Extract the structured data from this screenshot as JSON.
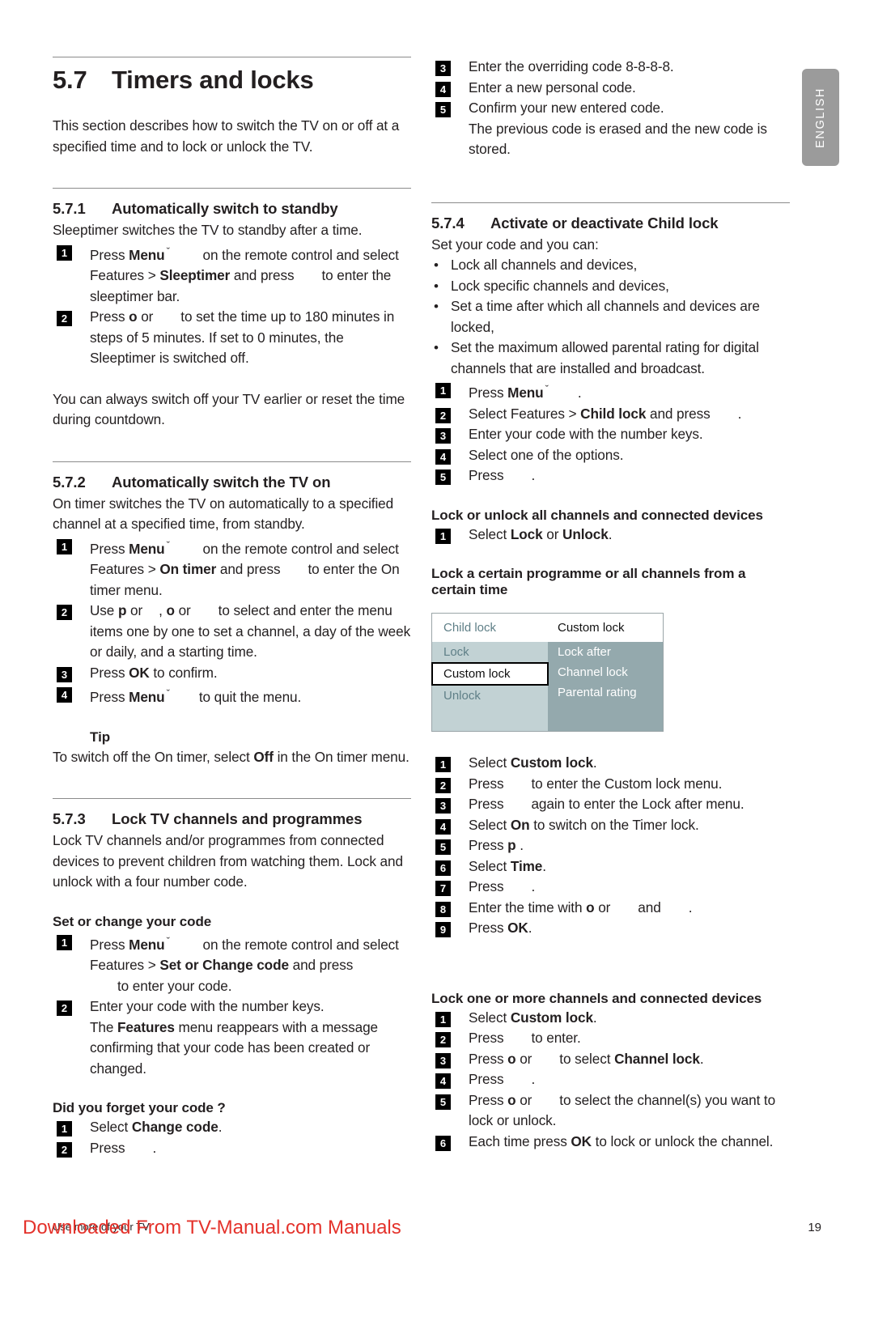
{
  "language_tab": {
    "label": "ENGLISH"
  },
  "chapter": {
    "number": "5.7",
    "title": "Timers and locks"
  },
  "intro": "This section describes how to switch the TV on or off at a specified time and to lock or unlock the TV.",
  "s571": {
    "number": "5.7.1",
    "title": "Automatically switch to standby",
    "intro": "Sleeptimer switches the TV to standby after a time.",
    "step1_a": "Press ",
    "step1_b": "Menu",
    "step1_c": " on the remote control and select Features > ",
    "step1_d": "Sleeptimer",
    "step1_e": " and press",
    "step1_f": "to enter the sleeptimer bar.",
    "step2_a": "Press ",
    "step2_b": "o",
    "step2_c": " or",
    "step2_d": "to set the time up to 180 minutes in steps of 5 minutes. If set to 0 minutes, the Sleeptimer is switched off.",
    "note": "You can always switch off your TV earlier or reset the time during countdown."
  },
  "s572": {
    "number": "5.7.2",
    "title": "Automatically switch the TV on",
    "intro": "On timer switches the TV on automatically to a specified channel at a specified time, from standby.",
    "step1_a": "Press ",
    "step1_b": "Menu",
    "step1_c": " on the remote control and select Features > ",
    "step1_d": "On timer",
    "step1_e": " and press",
    "step1_f": "to enter the On timer menu.",
    "step2_a": "Use ",
    "step2_b": "p",
    "step2_c": " or",
    "step2_d": ", ",
    "step2_e": "o",
    "step2_f": " or",
    "step2_g": "to select and enter the menu items one by one to set a channel, a day of the week or daily, and a starting time.",
    "step3_a": "Press ",
    "step3_b": "OK",
    "step3_c": " to confirm.",
    "step4_a": "Press ",
    "step4_b": "Menu",
    "step4_c": "to quit the menu.",
    "tip_title": "Tip",
    "tip_a": "To switch off the On timer, select ",
    "tip_b": "Off",
    "tip_c": " in the On timer menu."
  },
  "s573": {
    "number": "5.7.3",
    "title": "Lock TV channels and programmes",
    "intro": "Lock TV channels and/or programmes from connected devices to prevent children from watching them. Lock and unlock with a four number code.",
    "set_heading": "Set or change your code",
    "set_step1_a": "Press ",
    "set_step1_b": "Menu",
    "set_step1_c": " on the remote control and select Features > ",
    "set_step1_d": "Set or Change code",
    "set_step1_e": " and press",
    "set_step1_f": "to enter your code.",
    "set_step2_a": "Enter your code with the number keys.",
    "set_step2_b": "The ",
    "set_step2_c": "Features",
    "set_step2_d": " menu reappears with a message confirming that your code has been created or changed.",
    "forgot_heading": "Did you forget your code ?",
    "forgot_step1_a": "Select ",
    "forgot_step1_b": "Change code",
    "forgot_step1_c": ".",
    "forgot_step2_a": "Press",
    "forgot_step2_b": ".",
    "forgot_step3": "Enter the overriding code 8-8-8-8.",
    "forgot_step4": "Enter a new personal code.",
    "forgot_step5_a": "Confirm your new entered code.",
    "forgot_step5_b": "The previous code is erased and the new code is stored."
  },
  "s574": {
    "number": "5.7.4",
    "title": "Activate or deactivate Child lock",
    "intro": "Set your code and you can:",
    "bullets": [
      "Lock all channels and devices,",
      "Lock specific channels and devices,",
      "Set a time after which all channels and devices are locked,",
      "Set the maximum allowed parental rating for digital channels that are installed and broadcast."
    ],
    "step1_a": "Press ",
    "step1_b": "Menu",
    "step1_c": ".",
    "step2_a": "Select Features > ",
    "step2_b": "Child lock",
    "step2_c": " and press",
    "step2_d": ".",
    "step3": "Enter your code with the number keys.",
    "step4": "Select one of the options.",
    "step5_a": "Press",
    "step5_b": ".",
    "unlock_heading": "Lock or unlock all channels and connected devices",
    "unlock_step1_a": "Select ",
    "unlock_step1_b": "Lock",
    "unlock_step1_c": " or ",
    "unlock_step1_d": "Unlock",
    "unlock_step1_e": ".",
    "certain_heading": "Lock a certain programme or all channels from a certain time",
    "menu_image": {
      "header_left": "Child lock",
      "header_right": "Custom lock",
      "left_items": [
        "Lock",
        "Custom lock",
        "Unlock"
      ],
      "right_items": [
        "Lock after",
        "Channel lock",
        "Parental rating"
      ],
      "selected_left": "Custom lock",
      "colors": {
        "left_panel": "#c2d2d4",
        "right_panel": "#94a9ad",
        "border": "#9aa5a8",
        "left_text": "#5f7f87",
        "right_text": "#ffffff"
      }
    },
    "certain_steps": {
      "s1_a": "Select ",
      "s1_b": "Custom lock",
      "s1_c": ".",
      "s2_a": "Press",
      "s2_b": "to enter the Custom lock menu.",
      "s3_a": "Press",
      "s3_b": "again to enter the Lock after menu.",
      "s4_a": "Select ",
      "s4_b": "On",
      "s4_c": " to switch on the Timer lock.",
      "s5_a": "Press ",
      "s5_b": "p",
      "s5_c": " .",
      "s6_a": "Select ",
      "s6_b": "Time",
      "s6_c": ".",
      "s7_a": "Press",
      "s7_b": ".",
      "s8_a": "Enter the time with ",
      "s8_b": "o",
      "s8_c": " or",
      "s8_d": "and",
      "s8_e": ".",
      "s9_a": "Press ",
      "s9_b": "OK",
      "s9_c": "."
    },
    "one_more_heading": "Lock one or more channels and connected devices",
    "one_more_steps": {
      "s1_a": "Select ",
      "s1_b": "Custom lock",
      "s1_c": ".",
      "s2_a": "Press",
      "s2_b": "to enter.",
      "s3_a": "Press ",
      "s3_b": "o",
      "s3_c": " or",
      "s3_d": "to select ",
      "s3_e": "Channel lock",
      "s3_f": ".",
      "s4_a": "Press",
      "s4_b": ".",
      "s5_a": "Press ",
      "s5_b": "o",
      "s5_c": " or",
      "s5_d": "to select the channel(s) you want to lock or unlock.",
      "s6_a": "Each time press ",
      "s6_b": "OK",
      "s6_c": " to lock or unlock the channel."
    }
  },
  "footer": {
    "left": "Use more of your TV",
    "page_number": "19",
    "watermark": "Downloaded From TV-Manual.com Manuals",
    "watermark_color": "#e4322b"
  }
}
